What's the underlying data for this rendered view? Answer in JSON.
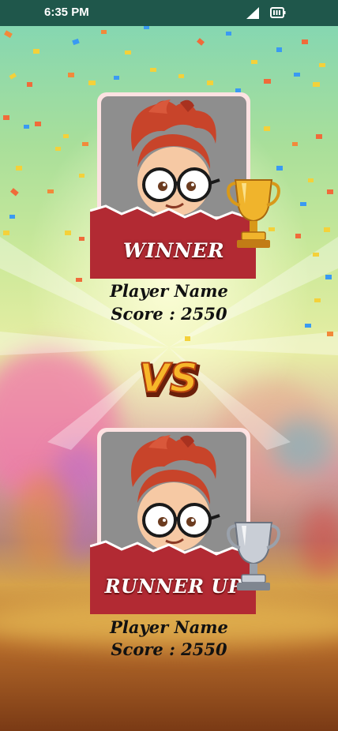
{
  "status_bar": {
    "time": "6:35 PM"
  },
  "winner": {
    "label": "WINNER",
    "player_name": "Player Name",
    "score": "Score : 2550",
    "trophy": "gold-trophy-icon"
  },
  "versus": {
    "label": "VS"
  },
  "runner_up": {
    "label": "RUNNER UP",
    "player_name": "Player Name",
    "score": "Score : 2550",
    "trophy": "silver-trophy-icon"
  },
  "colors": {
    "status_bar": "#1f574b",
    "ribbon": "#b22a33",
    "frame": "#fde2e2",
    "text": "#111111"
  }
}
